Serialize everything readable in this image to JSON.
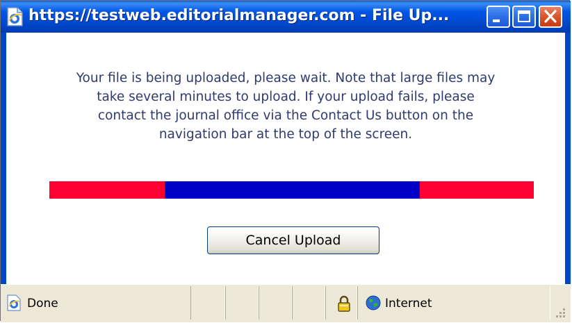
{
  "window": {
    "title": "https://testweb.editorialmanager.com - File Up...",
    "app_icon": "ie-page-icon",
    "controls": [
      "minimize-icon",
      "maximize-icon",
      "close-icon"
    ]
  },
  "message": {
    "lines": [
      "Your file is being uploaded, please wait. Note that large files may",
      "take several minutes to upload. If your upload fails, please",
      "contact the journal office via the Contact Us button on the",
      "navigation bar at the top of the screen."
    ]
  },
  "progress": {
    "indicator": "marquee",
    "colors": {
      "track": "#ff0033",
      "fill": "#0000c8"
    }
  },
  "buttons": {
    "cancel_label": "Cancel Upload"
  },
  "statusbar": {
    "status_text": "Done",
    "zone_text": "Internet",
    "icons": [
      "ie-page-icon",
      "lock-icon",
      "globe-icon",
      "resize-grip-icon"
    ]
  },
  "colors": {
    "titlebar": "#0046c9",
    "text": "#2f3a6e",
    "close_button": "#d8542a"
  }
}
